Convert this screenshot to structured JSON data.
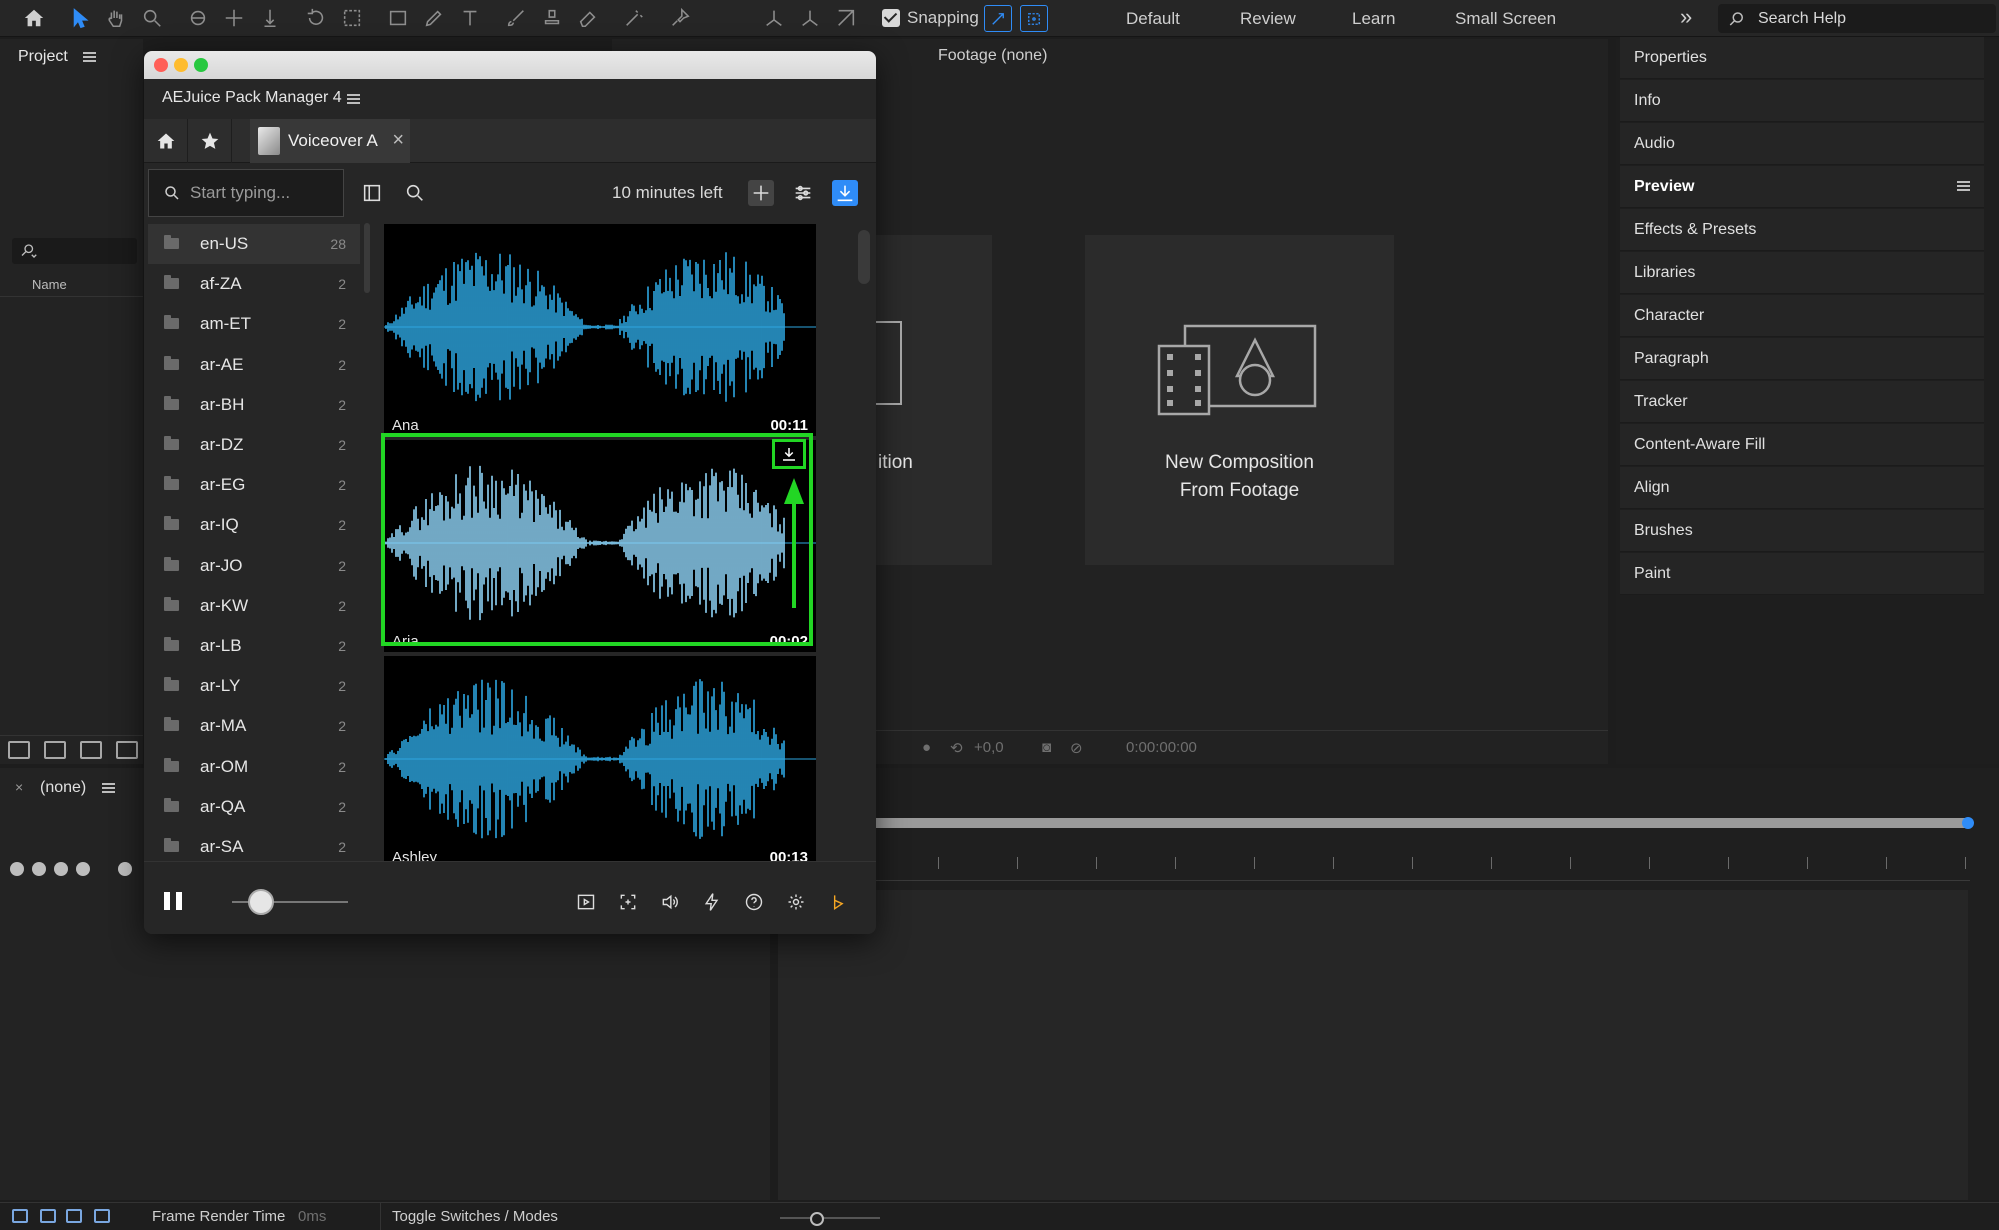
{
  "toolbar": {
    "snapping_label": "Snapping",
    "workspaces": [
      "Default",
      "Review",
      "Learn",
      "Small Screen"
    ],
    "search_help_placeholder": "Search Help"
  },
  "project_panel": {
    "title": "Project",
    "name_column": "Name"
  },
  "viewer": {
    "footage_title": "Footage (none)",
    "card_left_text": "ition",
    "card_right_line1": "New Composition",
    "card_right_line2": "From Footage",
    "exposure": "+0,0",
    "timecode": "0:00:00:00"
  },
  "right_panels": {
    "items": [
      "Properties",
      "Info",
      "Audio",
      "Preview",
      "Effects & Presets",
      "Libraries",
      "Character",
      "Paragraph",
      "Tracker",
      "Content-Aware Fill",
      "Align",
      "Brushes",
      "Paint"
    ],
    "active": "Preview"
  },
  "timeline": {
    "title": "(none)",
    "close": "×"
  },
  "status_bar": {
    "frame_render_label": "Frame Render Time",
    "frame_render_value": "0ms",
    "toggle_label": "Toggle Switches / Modes"
  },
  "aejuice": {
    "title": "AEJuice Pack Manager 4",
    "tab_label": "Voiceover A",
    "search_placeholder": "Start typing...",
    "minutes_left": "10 minutes left",
    "languages": [
      {
        "code": "en-US",
        "count": "28"
      },
      {
        "code": "af-ZA",
        "count": "2"
      },
      {
        "code": "am-ET",
        "count": "2"
      },
      {
        "code": "ar-AE",
        "count": "2"
      },
      {
        "code": "ar-BH",
        "count": "2"
      },
      {
        "code": "ar-DZ",
        "count": "2"
      },
      {
        "code": "ar-EG",
        "count": "2"
      },
      {
        "code": "ar-IQ",
        "count": "2"
      },
      {
        "code": "ar-JO",
        "count": "2"
      },
      {
        "code": "ar-KW",
        "count": "2"
      },
      {
        "code": "ar-LB",
        "count": "2"
      },
      {
        "code": "ar-LY",
        "count": "2"
      },
      {
        "code": "ar-MA",
        "count": "2"
      },
      {
        "code": "ar-OM",
        "count": "2"
      },
      {
        "code": "ar-QA",
        "count": "2"
      },
      {
        "code": "ar-SA",
        "count": "2"
      }
    ],
    "voices": [
      {
        "name": "Ana",
        "duration": "00:11"
      },
      {
        "name": "Aria",
        "duration": "00:02"
      },
      {
        "name": "Ashley",
        "duration": "00:13"
      }
    ],
    "volume": 0.25,
    "colors": {
      "accent": "#2f8cf7",
      "highlight": "#22d624",
      "waveform": "#2ea6e0"
    }
  }
}
